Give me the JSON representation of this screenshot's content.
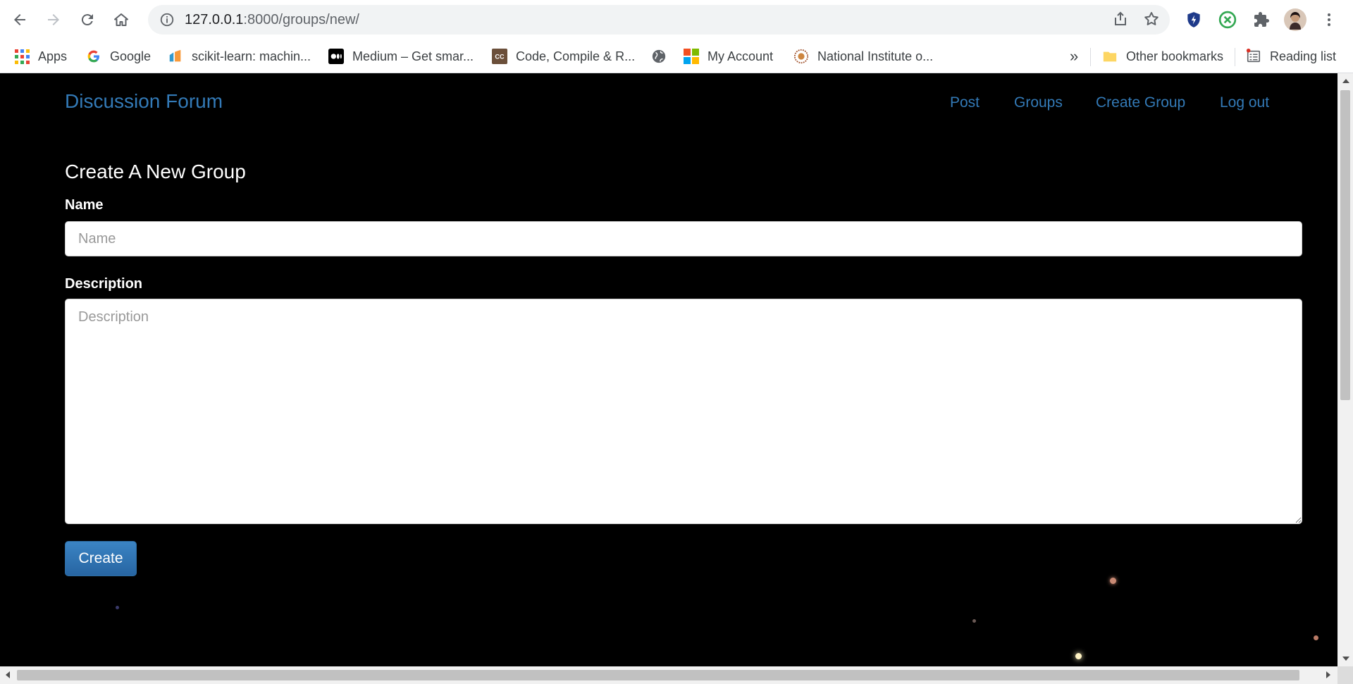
{
  "browser": {
    "url_host": "127.0.0.1",
    "url_path": ":8000/groups/new/",
    "bookmarks": [
      {
        "label": "Apps"
      },
      {
        "label": "Google"
      },
      {
        "label": "scikit-learn: machin..."
      },
      {
        "label": "Medium – Get smar..."
      },
      {
        "label": "Code, Compile & R..."
      },
      {
        "label": "My Account"
      },
      {
        "label": "National Institute o..."
      }
    ],
    "overflow_label": "»",
    "other_bookmarks": "Other bookmarks",
    "reading_list": "Reading list"
  },
  "site": {
    "brand": "Discussion Forum",
    "nav": [
      "Post",
      "Groups",
      "Create Group",
      "Log out"
    ],
    "link_color": "#337ab7"
  },
  "form": {
    "title": "Create A New Group",
    "name_label": "Name",
    "name_placeholder": "Name",
    "description_label": "Description",
    "description_placeholder": "Description",
    "submit_label": "Create"
  }
}
